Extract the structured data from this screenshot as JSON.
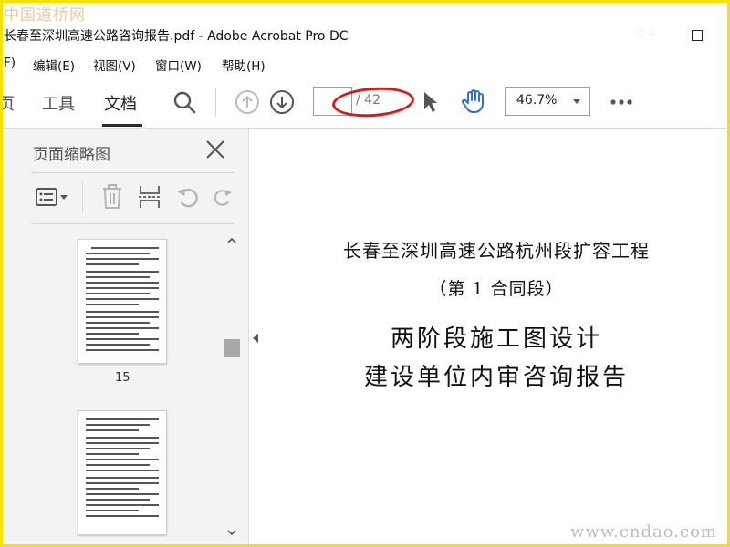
{
  "watermarks": {
    "top": "中国道桥网",
    "bottom": "www.cndao.com"
  },
  "window": {
    "title": "长春至深圳高速公路咨询报告.pdf - Adobe Acrobat Pro DC"
  },
  "menu": [
    {
      "label": "F)"
    },
    {
      "label": "编辑(E)"
    },
    {
      "label": "视图(V)"
    },
    {
      "label": "窗口(W)"
    },
    {
      "label": "帮助(H)"
    }
  ],
  "toolbar": {
    "tabs": [
      {
        "label": "页"
      },
      {
        "label": "工具"
      },
      {
        "label": "文档"
      }
    ],
    "active_tab": "文档",
    "page_current": "",
    "page_total": "/ 42",
    "zoom": "46.7%",
    "icons": [
      "search-icon",
      "prev-page-icon",
      "next-page-icon",
      "select-cursor-icon",
      "hand-tool-icon",
      "more-icon"
    ],
    "annotation_color": "#d61a1a"
  },
  "sidebar": {
    "title": "页面缩略图",
    "tools": [
      "page-options-icon",
      "delete-icon",
      "extract-icon",
      "undo-icon",
      "redo-icon"
    ],
    "thumbnails": [
      {
        "label": "15"
      },
      {
        "label": ""
      }
    ]
  },
  "document": {
    "line1": "长春至深圳高速公路杭州段扩容工程",
    "line2": "（第 1 合同段）",
    "line3": "两阶段施工图设计",
    "line4": "建设单位内审咨询报告"
  },
  "colors": {
    "frame": "#f2e400",
    "sidebar_bg": "#f3f3f3",
    "accent_blue": "#2d6fd6"
  }
}
